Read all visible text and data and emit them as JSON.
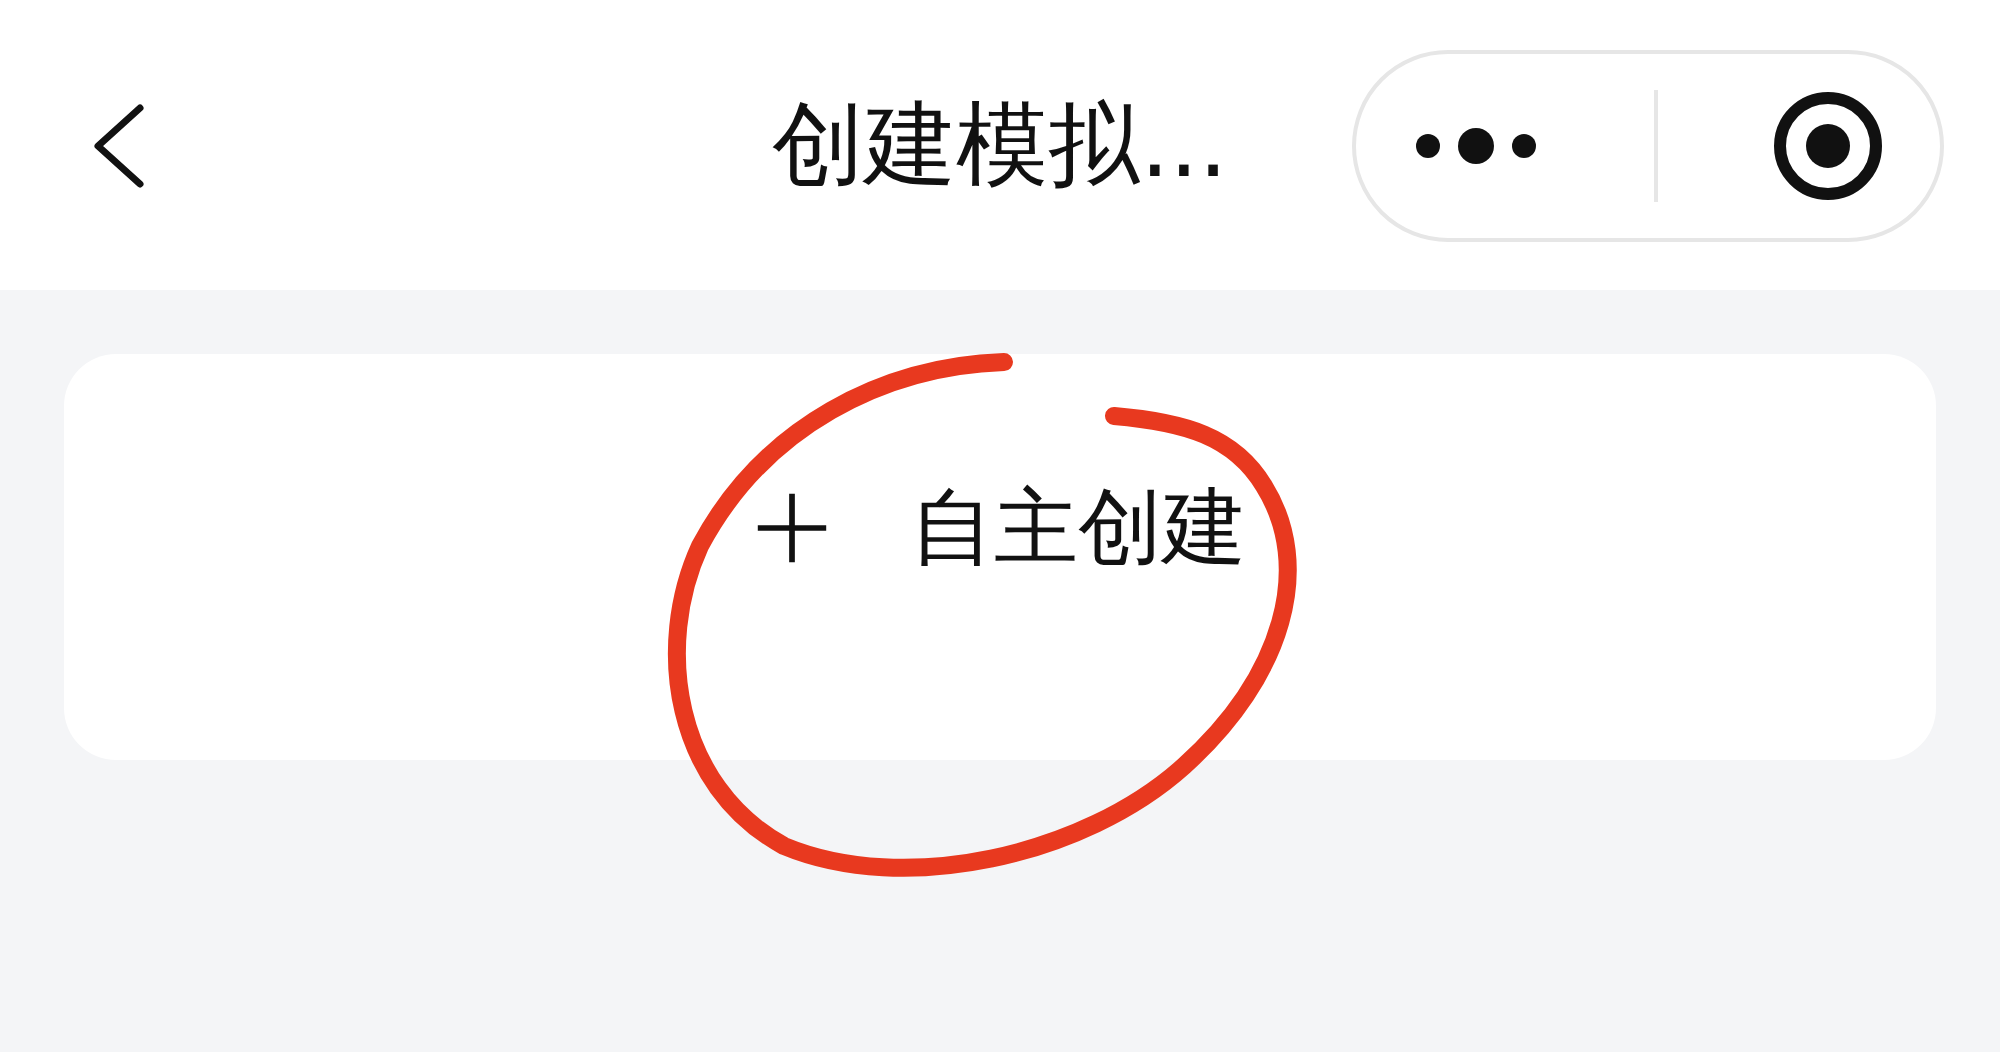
{
  "nav": {
    "title": "创建模拟..."
  },
  "create_card": {
    "label": "自主创建"
  },
  "annotation": {
    "kind": "circle",
    "color": "#e8391f"
  }
}
